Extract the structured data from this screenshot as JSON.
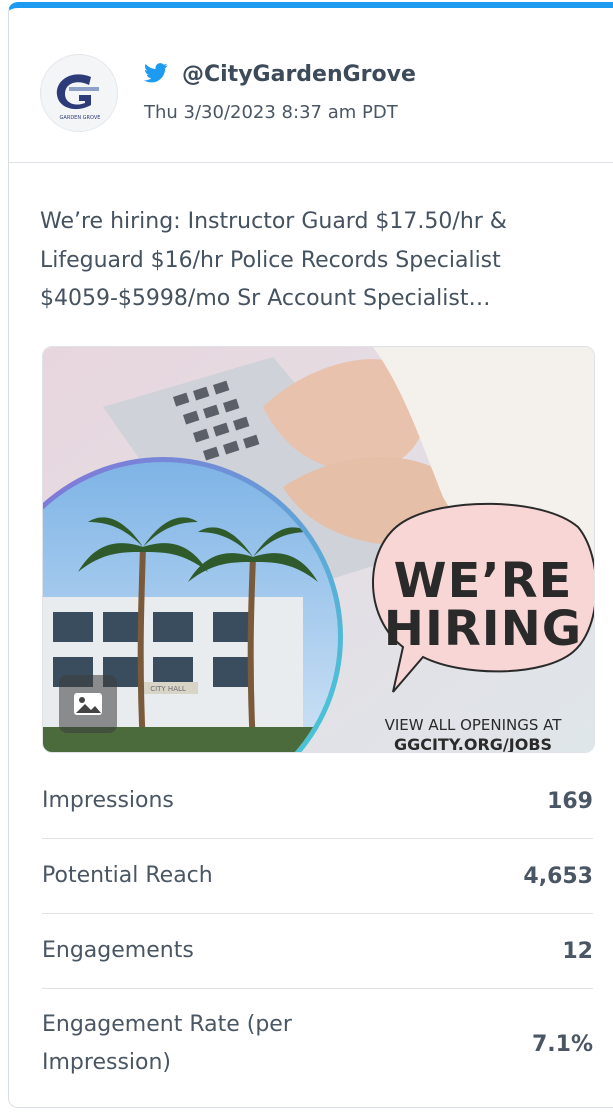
{
  "post": {
    "handle": "@CityGardenGrove",
    "timestamp": "Thu 3/30/2023 8:37 am PDT",
    "text": "We’re hiring: Instructor Guard $17.50/hr & Lifeguard $16/hr Police Records Specialist $4059-$5998/mo Sr Account Specialist…",
    "platform_icon": "twitter-bird-icon",
    "accent_color": "#1d9bf0"
  },
  "avatar": {
    "logo_text": "GARDEN GROVE"
  },
  "media": {
    "headline_line1": "WE’RE",
    "headline_line2": "HIRING",
    "footer_line1": "VIEW ALL OPENINGS AT",
    "footer_line2": "GGCITY.ORG/JOBS",
    "building_sign": "CITY HALL",
    "badge_icon": "image-icon"
  },
  "metrics": [
    {
      "label": "Impressions",
      "value": "169"
    },
    {
      "label": "Potential Reach",
      "value": "4,653"
    },
    {
      "label": "Engagements",
      "value": "12"
    },
    {
      "label": "Engagement Rate (per Impression)",
      "value": "7.1%"
    }
  ]
}
